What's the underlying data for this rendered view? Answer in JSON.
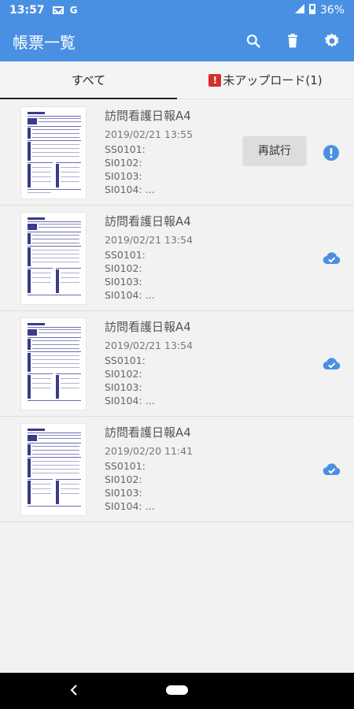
{
  "status_bar": {
    "time": "13:57",
    "g": "G",
    "battery": "36%"
  },
  "app_bar": {
    "title": "帳票一覧"
  },
  "tabs": [
    {
      "label": "すべて"
    },
    {
      "label": "未アップロード(1)",
      "badge": "!"
    }
  ],
  "items": [
    {
      "title": "訪問看護日報A4",
      "datetime": "2019/02/21 13:55",
      "fields": [
        "SS0101:",
        "SI0102:",
        "SI0103:",
        "SI0104: ..."
      ],
      "status": "error",
      "retry_label": "再試行"
    },
    {
      "title": "訪問看護日報A4",
      "datetime": "2019/02/21 13:54",
      "fields": [
        "SS0101:",
        "SI0102:",
        "SI0103:",
        "SI0104: ..."
      ],
      "status": "uploaded"
    },
    {
      "title": "訪問看護日報A4",
      "datetime": "2019/02/21 13:54",
      "fields": [
        "SS0101:",
        "SI0102:",
        "SI0103:",
        "SI0104: ..."
      ],
      "status": "uploaded"
    },
    {
      "title": "訪問看護日報A4",
      "datetime": "2019/02/20 11:41",
      "fields": [
        "SS0101:",
        "SI0102:",
        "SI0103:",
        "SI0104: ..."
      ],
      "status": "uploaded"
    }
  ],
  "icons": {
    "search": "search-icon",
    "delete": "trash-icon",
    "settings": "gear-icon",
    "error": "info-alert-icon",
    "uploaded": "cloud-check-icon"
  },
  "colors": {
    "primary": "#4a90e2",
    "error": "#d32f2f",
    "icon_blue": "#4a90e2"
  }
}
